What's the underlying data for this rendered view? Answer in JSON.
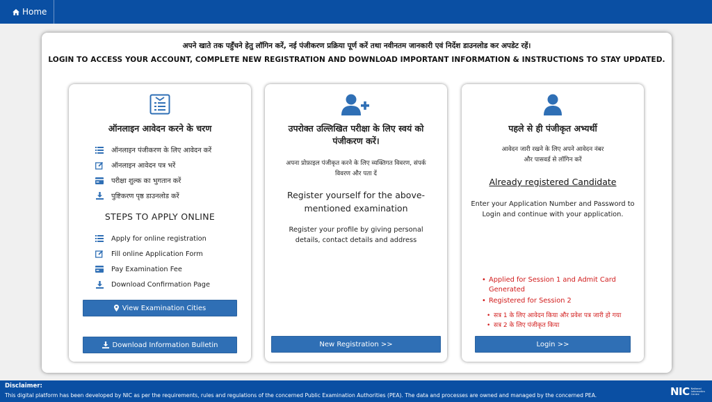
{
  "header": {
    "home_label": "Home"
  },
  "intro": {
    "hindi": "अपने खाते तक पहुँचने हेतु लॉगिन करें, नई पंजीकरण प्रक्रिया पूर्ण करें तथा नवीनतम जानकारी एवं निर्देश डाउनलोड कर अपडेट रहें।",
    "english": "LOGIN TO ACCESS YOUR ACCOUNT, COMPLETE NEW REGISTRATION AND DOWNLOAD IMPORTANT INFORMATION & INSTRUCTIONS TO STAY UPDATED."
  },
  "card_steps": {
    "icon": "form-list-icon",
    "title_hi": "ऑनलाइन आवेदन करने के चरण",
    "steps_hi": [
      {
        "icon": "list-icon",
        "label": "ऑनलाइन पंजीकरण के लिए आवेदन करें"
      },
      {
        "icon": "edit-icon",
        "label": "ऑनलाइन आवेदन पत्र भरें"
      },
      {
        "icon": "card-icon",
        "label": "परीक्षा शुल्क का भुगतान करें"
      },
      {
        "icon": "download-icon",
        "label": "पुष्टिकरण पृष्ठ डाउनलोड करें"
      }
    ],
    "heading_en": "STEPS TO APPLY ONLINE",
    "steps_en": [
      {
        "icon": "list-icon",
        "label": "Apply for online registration"
      },
      {
        "icon": "edit-icon",
        "label": "Fill online Application Form"
      },
      {
        "icon": "card-icon",
        "label": "Pay Examination Fee"
      },
      {
        "icon": "download-icon",
        "label": "Download Confirmation Page"
      }
    ],
    "btn_cities": "View Examination Cities",
    "btn_bulletin": "Download Information Bulletin"
  },
  "card_register": {
    "icon": "user-plus-icon",
    "title_hi": "उपरोक्त उल्लिखित परीक्षा के लिए स्वयं को पंजीकरण करें।",
    "desc_hi": "अपना प्रोफ़ाइल पंजीकृत करने के लिए व्यक्तिगत विवरण, संपर्क विवरण और पता दें",
    "title_en": "Register yourself for the above-mentioned examination",
    "desc_en": "Register your profile by giving personal details, contact details and address",
    "btn": "New Registration >>"
  },
  "card_login": {
    "icon": "user-icon",
    "title_hi": "पहले से ही पंजीकृत अभ्यर्थी",
    "desc_hi": "आवेदन जारी रखने के लिए अपने आवेदन नंबर और पासवर्ड से लॉगिन करें",
    "title_en": "Already registered Candidate",
    "desc_en": "Enter your Application Number and Password to Login and continue with your application.",
    "status_en": [
      "Applied for Session 1 and Admit Card Generated",
      "Registered for Session 2"
    ],
    "status_hi": [
      "सत्र 1 के लिए आवेदन किया और प्रवेश पत्र जारी हो गया",
      "सत्र 2 के लिए पंजीकृत किया"
    ],
    "btn": "Login >>"
  },
  "footer": {
    "title": "Disclaimer:",
    "text": "This digital platform has been developed by NIC as per the requirements, rules and regulations of the concerned Public Examination Authorities (PEA). The data and processes are owned and managed by the concerned PEA.",
    "logo_text": "NIC",
    "logo_sub": "National Informatics Centre"
  },
  "colors": {
    "brand_blue": "#0a4fa3",
    "button_blue": "#2f6fb5",
    "status_red": "#d11a1a"
  }
}
